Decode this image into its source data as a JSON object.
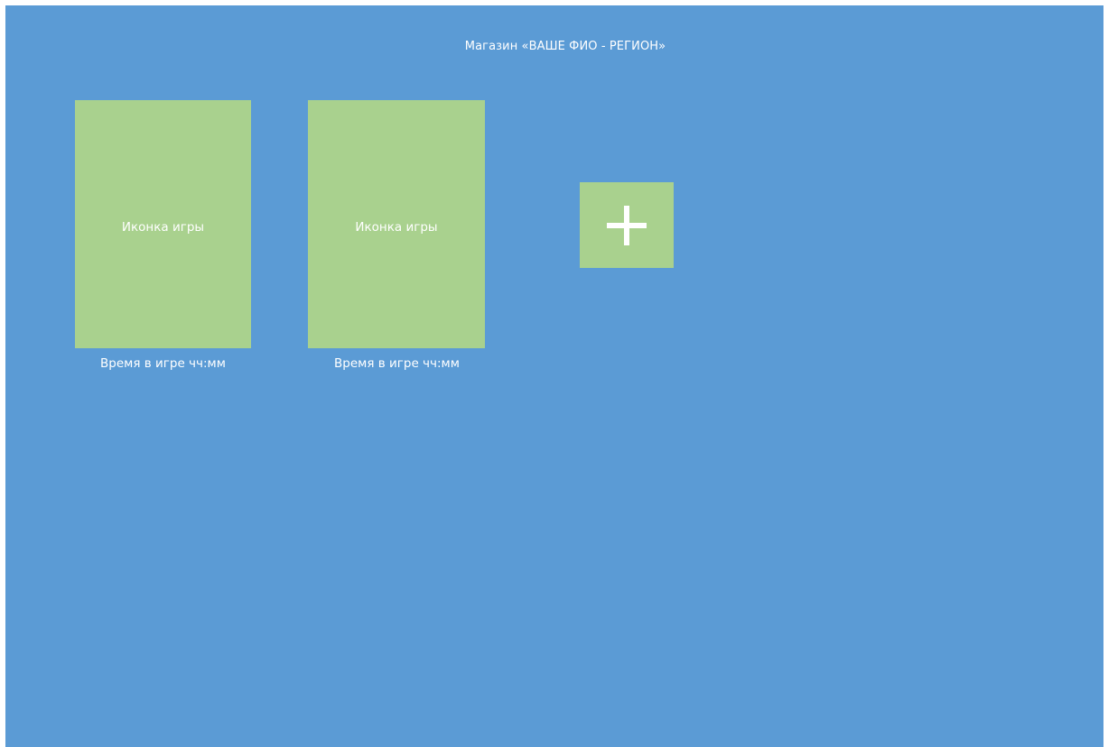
{
  "shop": {
    "title": "Магазин «ВАШЕ ФИО - РЕГИОН»"
  },
  "games": [
    {
      "icon_label": "Иконка игры",
      "play_time": "Время в игре чч:мм"
    },
    {
      "icon_label": "Иконка игры",
      "play_time": "Время в игре чч:мм"
    }
  ],
  "add_button": {
    "icon": "plus-icon"
  },
  "colors": {
    "background": "#5b9bd5",
    "tile": "#a9d18e",
    "text": "#ffffff"
  }
}
